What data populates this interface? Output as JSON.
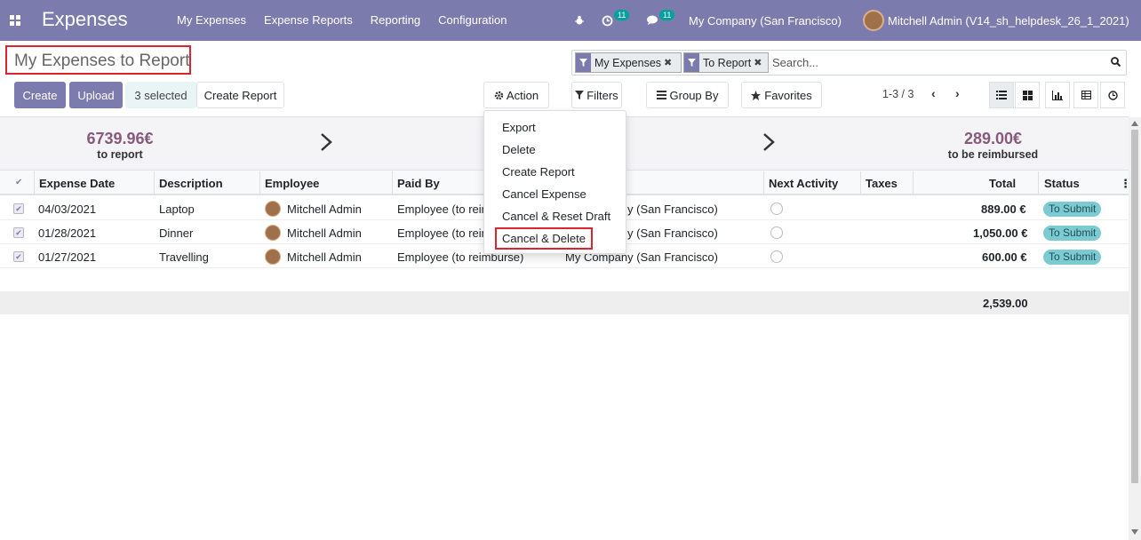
{
  "navbar": {
    "app_title": "Expenses",
    "menu": [
      "My Expenses",
      "Expense Reports",
      "Reporting",
      "Configuration"
    ],
    "activity_count": "11",
    "message_count": "11",
    "company": "My Company (San Francisco)",
    "user": "Mitchell Admin (V14_sh_helpdesk_26_1_2021)"
  },
  "control_panel": {
    "title": "My Expenses to Report",
    "create_label": "Create",
    "upload_label": "Upload",
    "selected_label": "3 selected",
    "create_report_label": "Create Report",
    "action_label": "Action",
    "filters_label": "Filters",
    "groupby_label": "Group By",
    "favorites_label": "Favorites",
    "pager": "1-3 / 3"
  },
  "search": {
    "facets": [
      "My Expenses",
      "To Report"
    ],
    "placeholder": "Search..."
  },
  "summary": {
    "to_report_value": "6739.96€",
    "to_report_label": "to report",
    "reimbursed_value": "289.00€",
    "reimbursed_label": "to be reimbursed"
  },
  "table": {
    "columns": [
      "Expense Date",
      "Description",
      "Employee",
      "Paid By",
      "Next Activity",
      "Taxes",
      "Total",
      "Status"
    ],
    "rows": [
      {
        "date": "04/03/2021",
        "description": "Laptop",
        "employee": "Mitchell Admin",
        "paid_by": "Employee (to reir",
        "company": "y (San Francisco)",
        "total": "889.00 €",
        "status": "To Submit"
      },
      {
        "date": "01/28/2021",
        "description": "Dinner",
        "employee": "Mitchell Admin",
        "paid_by": "Employee (to reir",
        "company": "y (San Francisco)",
        "total": "1,050.00 €",
        "status": "To Submit"
      },
      {
        "date": "01/27/2021",
        "description": "Travelling",
        "employee": "Mitchell Admin",
        "paid_by": "Employee (to reimburse)",
        "company": "My Company (San Francisco)",
        "total": "600.00 €",
        "status": "To Submit"
      }
    ],
    "grand_total": "2,539.00"
  },
  "action_menu": {
    "items": [
      "Export",
      "Delete",
      "Create Report",
      "Cancel Expense",
      "Cancel & Reset Draft",
      "Cancel & Delete"
    ]
  },
  "colors": {
    "brand": "#7c7bad",
    "highlight": "#d9262e",
    "summary_value": "#875a7b",
    "status_badge": "#7ccbd3"
  }
}
